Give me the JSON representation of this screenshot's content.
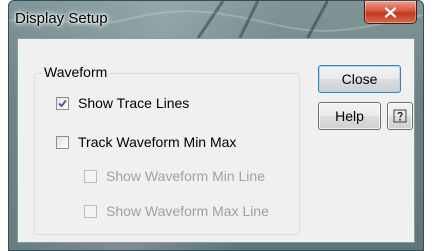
{
  "window": {
    "title": "Display Setup"
  },
  "group": {
    "label": "Waveform"
  },
  "checkboxes": [
    {
      "label": "Show Trace Lines",
      "checked": true,
      "enabled": true
    },
    {
      "label": "Track Waveform Min Max",
      "checked": false,
      "enabled": true
    },
    {
      "label": "Show Waveform Min Line",
      "checked": false,
      "enabled": false
    },
    {
      "label": "Show Waveform Max Line",
      "checked": false,
      "enabled": false
    }
  ],
  "buttons": {
    "close_label": "Close",
    "help_label": "Help"
  },
  "icons": {
    "title_close": "close-x-icon",
    "help": "context-help-icon",
    "check": "checkmark-icon"
  }
}
